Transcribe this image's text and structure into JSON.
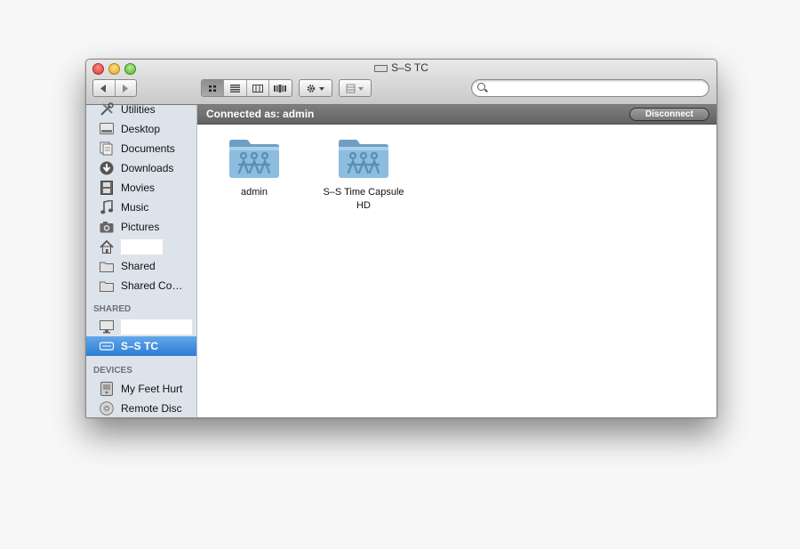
{
  "window": {
    "title": "S–S TC"
  },
  "toolbar": {
    "back_icon": "chevron-left-icon",
    "forward_icon": "chevron-right-icon",
    "views": [
      "icon-view",
      "list-view",
      "column-view",
      "coverflow-view"
    ],
    "active_view": "icon-view",
    "action_icon": "gear-icon",
    "arrange_icon": "arrange-icon",
    "search": {
      "value": "",
      "placeholder": ""
    }
  },
  "sidebar": {
    "favorites": [
      {
        "label": "Utilities",
        "icon": "utilities-icon"
      },
      {
        "label": "Desktop",
        "icon": "desktop-icon"
      },
      {
        "label": "Documents",
        "icon": "documents-icon"
      },
      {
        "label": "Downloads",
        "icon": "downloads-icon"
      },
      {
        "label": "Movies",
        "icon": "movies-icon"
      },
      {
        "label": "Music",
        "icon": "music-icon"
      },
      {
        "label": "Pictures",
        "icon": "pictures-icon"
      },
      {
        "label": "",
        "icon": "home-icon"
      },
      {
        "label": "Shared",
        "icon": "folder-icon"
      },
      {
        "label": "Shared Co…",
        "icon": "folder-icon"
      }
    ],
    "shared_header": "SHARED",
    "shared": [
      {
        "label": "",
        "icon": "monitor-icon"
      },
      {
        "label": "S–S TC",
        "icon": "drive-icon",
        "selected": true
      }
    ],
    "devices_header": "DEVICES",
    "devices": [
      {
        "label": "My Feet Hurt",
        "icon": "disk-icon"
      },
      {
        "label": "Remote Disc",
        "icon": "disc-icon"
      }
    ]
  },
  "pathbar": {
    "connected_label": "Connected as: admin",
    "disconnect_label": "Disconnect"
  },
  "content": {
    "items": [
      {
        "label": "admin",
        "icon": "shared-folder-icon"
      },
      {
        "label": "S–S Time Capsule HD",
        "icon": "shared-folder-icon"
      }
    ]
  },
  "colors": {
    "selection": "#2c7dd6",
    "sidebar_bg": "#dde3ea",
    "folder_blue": "#7fb2d6"
  }
}
